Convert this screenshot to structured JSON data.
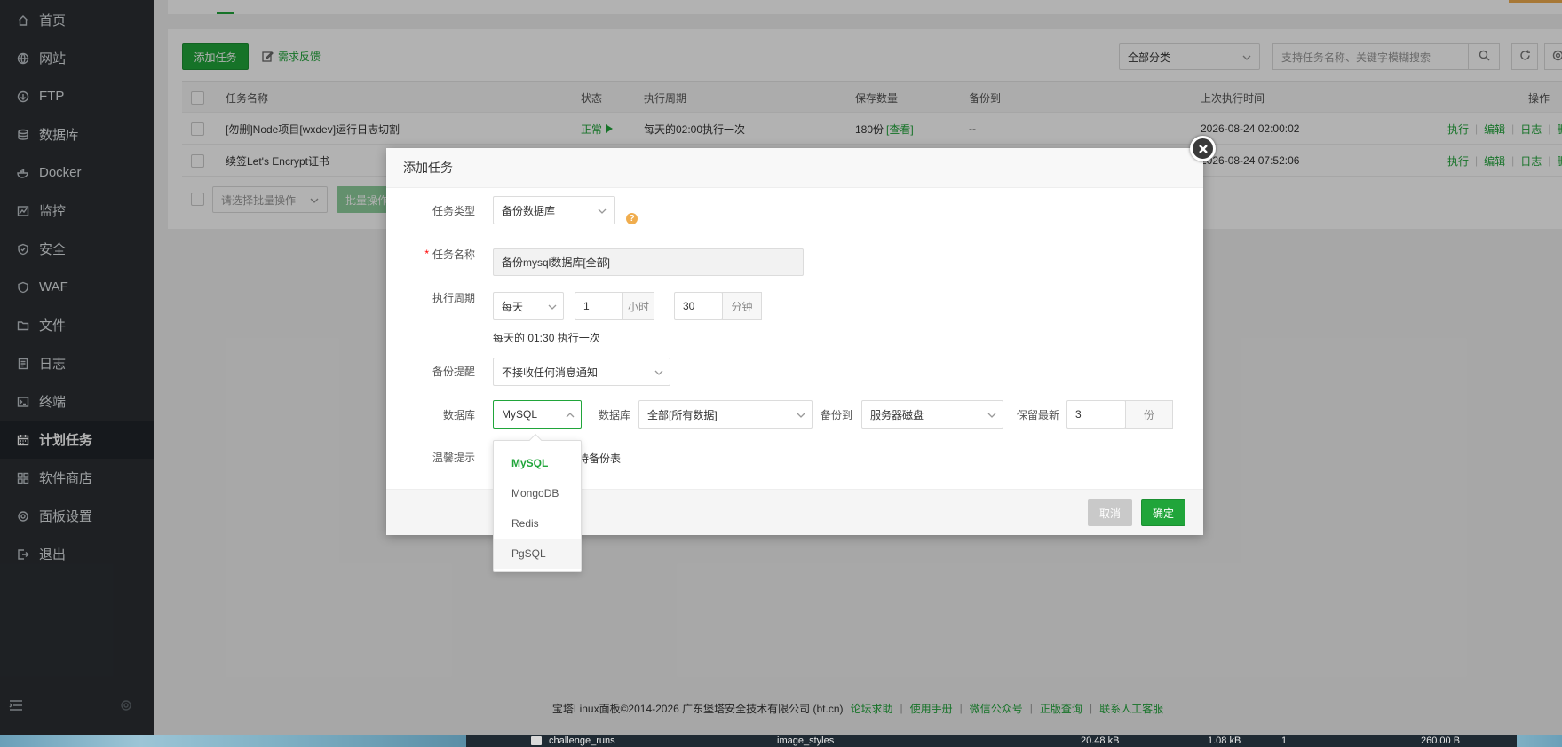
{
  "sidebar": {
    "items": [
      {
        "label": "首页",
        "icon": "home-icon"
      },
      {
        "label": "网站",
        "icon": "globe-icon"
      },
      {
        "label": "FTP",
        "icon": "ftp-icon"
      },
      {
        "label": "数据库",
        "icon": "database-icon"
      },
      {
        "label": "Docker",
        "icon": "docker-icon"
      },
      {
        "label": "监控",
        "icon": "monitor-icon"
      },
      {
        "label": "安全",
        "icon": "shield-icon"
      },
      {
        "label": "WAF",
        "icon": "waf-shield-icon"
      },
      {
        "label": "文件",
        "icon": "folder-icon"
      },
      {
        "label": "日志",
        "icon": "log-icon"
      },
      {
        "label": "终端",
        "icon": "terminal-icon"
      },
      {
        "label": "计划任务",
        "icon": "calendar-icon",
        "active": true
      },
      {
        "label": "软件商店",
        "icon": "grid-icon"
      },
      {
        "label": "面板设置",
        "icon": "settings-icon"
      },
      {
        "label": "退出",
        "icon": "logout-icon"
      }
    ]
  },
  "toolbar": {
    "add_task": "添加任务",
    "feedback": "需求反馈",
    "category": "全部分类",
    "search_placeholder": "支持任务名称、关键字模糊搜索"
  },
  "table": {
    "headers": [
      "任务名称",
      "状态",
      "执行周期",
      "保存数量",
      "备份到",
      "上次执行时间",
      "操作"
    ],
    "rows": [
      {
        "name": "[勿删]Node项目[wxdev]运行日志切割",
        "status": "正常",
        "cycle": "每天的02:00执行一次",
        "count": "180份",
        "count_link": "[查看]",
        "backup": "--",
        "last_run": "2026-08-24 02:00:02"
      },
      {
        "name": "续签Let's Encrypt证书",
        "status": "",
        "cycle": "",
        "count": "",
        "count_link": "",
        "backup": "",
        "last_run": "2026-08-24 07:52:06"
      }
    ],
    "ops": [
      "执行",
      "编辑",
      "日志",
      "删除"
    ],
    "batch_placeholder": "请选择批量操作",
    "batch_button": "批量操作"
  },
  "modal": {
    "title": "添加任务",
    "task_type_label": "任务类型",
    "task_type_value": "备份数据库",
    "task_name_label": "任务名称",
    "task_name_value": "备份mysql数据库[全部]",
    "cycle_label": "执行周期",
    "cycle_period": "每天",
    "cycle_hour": "1",
    "cycle_hour_unit": "小时",
    "cycle_minute": "30",
    "cycle_minute_unit": "分钟",
    "cycle_desc": "每天的 01:30 执行一次",
    "notify_label": "备份提醒",
    "notify_value": "不接收任何消息通知",
    "db_label": "数据库",
    "db_type_value": "MySQL",
    "db_name_label": "数据库",
    "db_name_value": "全部[所有数据]",
    "backup_to_label": "备份到",
    "backup_to_value": "服务器磁盘",
    "keep_label": "保留最新",
    "keep_value": "3",
    "keep_unit": "份",
    "tip_label": "温馨提示",
    "tip_text": "持备份表",
    "cancel": "取消",
    "confirm": "确定",
    "db_type_options": [
      "MySQL",
      "MongoDB",
      "Redis",
      "PgSQL"
    ]
  },
  "footer": {
    "copyright": "宝塔Linux面板©2014-2026 广东堡塔安全技术有限公司 (bt.cn)",
    "links": [
      "论坛求助",
      "使用手册",
      "微信公众号",
      "正版查询",
      "联系人工客服"
    ]
  },
  "taskbar": {
    "folder": "challenge_runs",
    "file": "image_styles",
    "size1": "20.48 kB",
    "size2": "1.08 kB",
    "count": "1",
    "size3": "260.00 B"
  },
  "colors": {
    "accent": "#20a53a",
    "sidebar_bg": "#2b2f33",
    "warning": "#f0ad4e"
  }
}
